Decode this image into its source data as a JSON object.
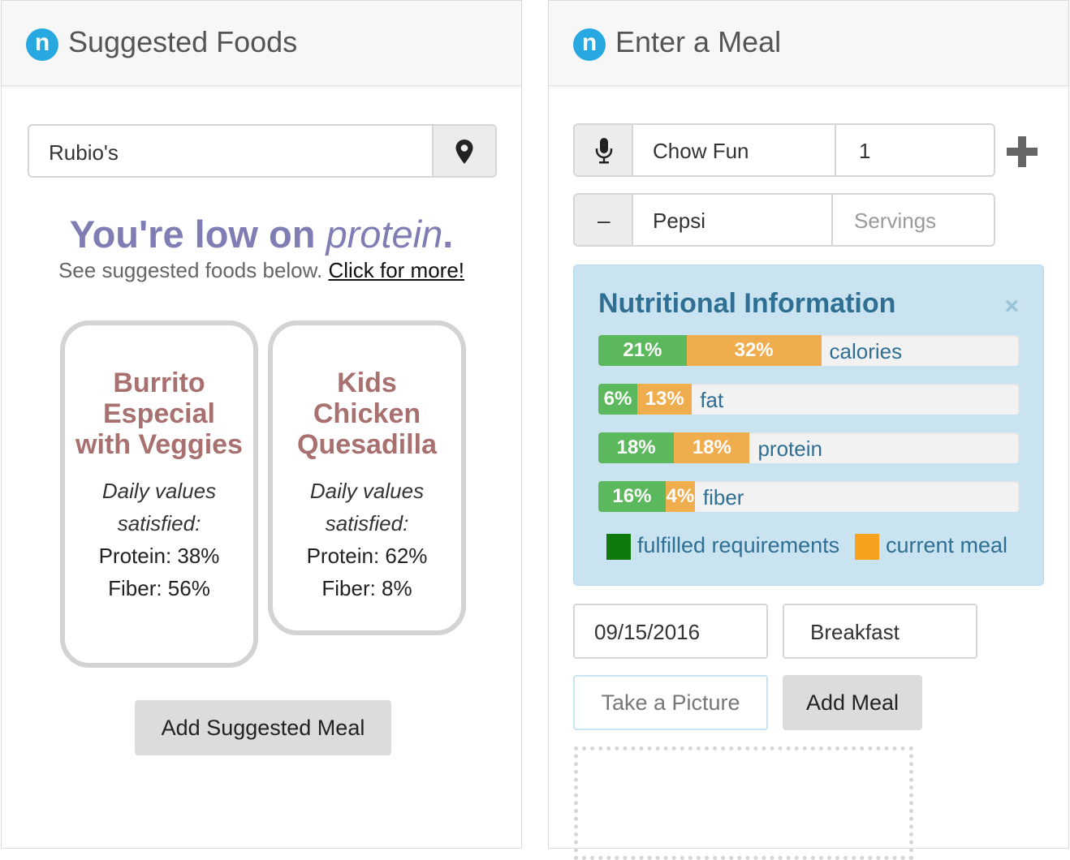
{
  "left": {
    "header": {
      "logo": "n",
      "title": "Suggested Foods"
    },
    "search": {
      "value": "Rubio's"
    },
    "headline": {
      "prefix": "You're low on ",
      "nutrient": "protein",
      "suffix": "."
    },
    "subline": {
      "text": "See suggested foods below. ",
      "link": "Click for more!"
    },
    "cards": [
      {
        "name": "Burrito Especial with Veggies",
        "dv_label": "Daily values satisfied:",
        "stats": [
          "Protein: 38%",
          "Fiber: 56%"
        ]
      },
      {
        "name": "Kids Chicken Quesadilla",
        "dv_label": "Daily values satisfied:",
        "stats": [
          "Protein: 62%",
          "Fiber: 8%"
        ]
      }
    ],
    "add_button": "Add Suggested Meal"
  },
  "right": {
    "header": {
      "logo": "n",
      "title": "Enter a Meal"
    },
    "rows": [
      {
        "food": "Chow Fun",
        "servings": "1",
        "servings_placeholder": ""
      },
      {
        "addon": "–",
        "food": "Pepsi",
        "servings": "",
        "servings_placeholder": "Servings"
      }
    ],
    "nutrition": {
      "title": "Nutritional Information",
      "close": "×",
      "bars": [
        {
          "label": "calories",
          "fulfilled": 21,
          "current": 32,
          "fulfilled_text": "21%",
          "current_text": "32%"
        },
        {
          "label": "fat",
          "fulfilled": 6,
          "current": 13,
          "fulfilled_text": "6%",
          "current_text": "13%"
        },
        {
          "label": "protein",
          "fulfilled": 18,
          "current": 18,
          "fulfilled_text": "18%",
          "current_text": "18%"
        },
        {
          "label": "fiber",
          "fulfilled": 16,
          "current": 4,
          "fulfilled_text": "16%",
          "current_text": "4%"
        }
      ],
      "legend": {
        "fulfilled": "fulfilled requirements",
        "current": "current meal"
      }
    },
    "date": "09/15/2016",
    "meal_type": "Breakfast",
    "take_picture": "Take a Picture",
    "add_meal": "Add Meal"
  },
  "colors": {
    "brand": "#27a8e0",
    "headline": "#7f7db4",
    "card_name": "#a97070",
    "fulfilled": "#5cb85c",
    "current": "#f0ad4e",
    "legend_fulfilled": "#0e7a0e",
    "legend_current": "#f7a11f",
    "info_bg": "#c9e3f1"
  },
  "icons": {
    "location": "map-pin-icon",
    "mic": "microphone-icon",
    "plus": "plus-icon",
    "close": "close-icon"
  }
}
